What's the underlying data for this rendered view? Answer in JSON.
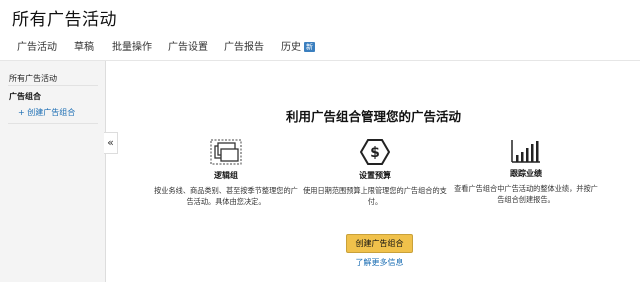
{
  "header": {
    "title": "所有广告活动",
    "tabs": [
      {
        "label": "广告活动"
      },
      {
        "label": "草稿"
      },
      {
        "label": "批量操作"
      },
      {
        "label": "广告设置"
      },
      {
        "label": "广告报告"
      },
      {
        "label": "历史",
        "badge": "新"
      }
    ]
  },
  "sidebar": {
    "all_campaigns": "所有广告活动",
    "portfolios": "广告组合",
    "create_portfolio": "+ 创建广告组合",
    "collapse_glyph": "«"
  },
  "main": {
    "heading": "利用广告组合管理您的广告活动",
    "features": [
      {
        "icon": "folders-icon",
        "title": "逻辑组",
        "desc": "按业务线、商品类别、甚至按季节整理您的广告活动。具体由您决定。"
      },
      {
        "icon": "dollar-budget-icon",
        "title": "设置预算",
        "desc": "使用日期范围预算上限管理您的广告组合的支付。"
      },
      {
        "icon": "bar-chart-icon",
        "title": "跟踪业绩",
        "desc": "查看广告组合中广告活动的整体业绩，并按广告组合创建报告。"
      }
    ],
    "create_button": "创建广告组合",
    "learn_more": "了解更多信息"
  },
  "colors": {
    "accent_button": "#f0c14b",
    "link": "#1a6db3",
    "badge": "#3b7fbf"
  }
}
